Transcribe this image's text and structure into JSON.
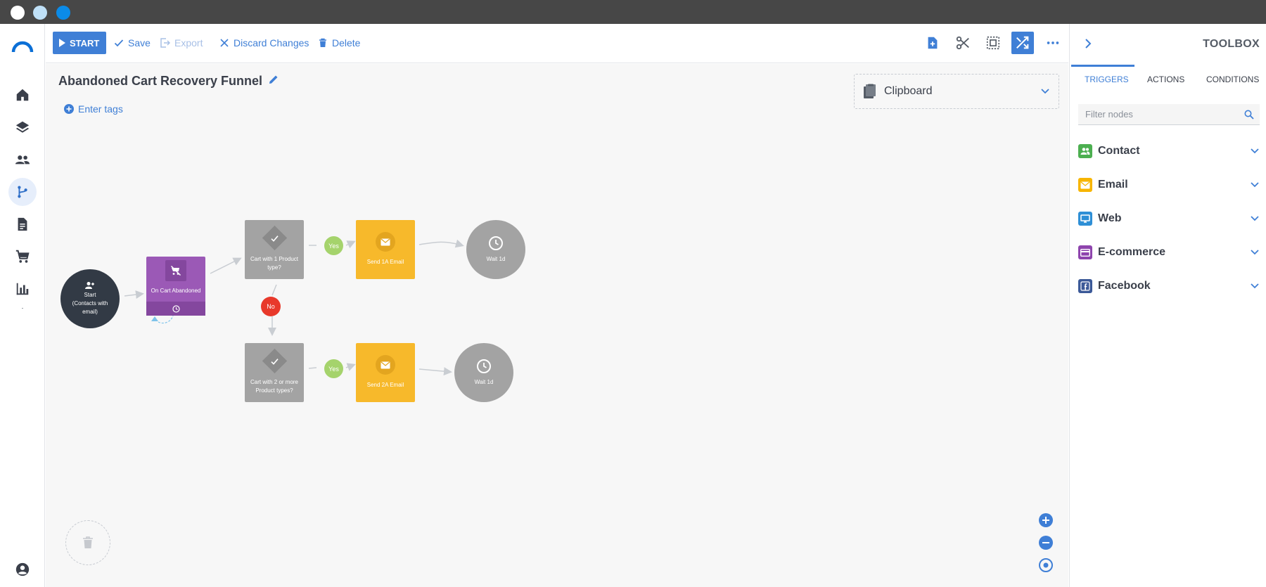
{
  "toolbar": {
    "start_label": "START",
    "save_label": "Save",
    "export_label": "Export",
    "discard_label": "Discard Changes",
    "delete_label": "Delete"
  },
  "canvas": {
    "title": "Abandoned Cart Recovery Funnel",
    "tags_label": "Enter tags",
    "clipboard_label": "Clipboard"
  },
  "flow": {
    "start_node": "Start\n(Contacts with email)",
    "trigger_node": "On Cart Abandoned",
    "condition_1": "Cart with 1 Product type?",
    "condition_2": "Cart with 2 or more Product types?",
    "email_1": "Send 1A Email",
    "email_2": "Send 2A Email",
    "wait_1": "Wait 1d",
    "wait_2": "Wait 1d",
    "yes_1": "Yes",
    "yes_2": "Yes",
    "no_1": "No"
  },
  "toolbox": {
    "title": "TOOLBOX",
    "tabs": [
      "TRIGGERS",
      "ACTIONS",
      "CONDITIONS"
    ],
    "active_tab": "TRIGGERS",
    "search_placeholder": "Filter nodes",
    "categories": [
      {
        "name": "Contact",
        "color": "#4caf50",
        "icon": "contacts-icon"
      },
      {
        "name": "Email",
        "color": "#f7b500",
        "icon": "email-icon"
      },
      {
        "name": "Web",
        "color": "#2e8fd6",
        "icon": "monitor-icon"
      },
      {
        "name": "E-commerce",
        "color": "#8e44ad",
        "icon": "card-icon"
      },
      {
        "name": "Facebook",
        "color": "#3b5998",
        "icon": "facebook-icon"
      }
    ]
  },
  "colors": {
    "accent": "#3f7fd6",
    "trigger_purple": "#9b59b6",
    "email_yellow": "#f7b92b",
    "condition_gray": "#a3a3a3",
    "yes_green": "#a5d36c",
    "no_red": "#e8392b",
    "start_dark": "#323a45"
  }
}
